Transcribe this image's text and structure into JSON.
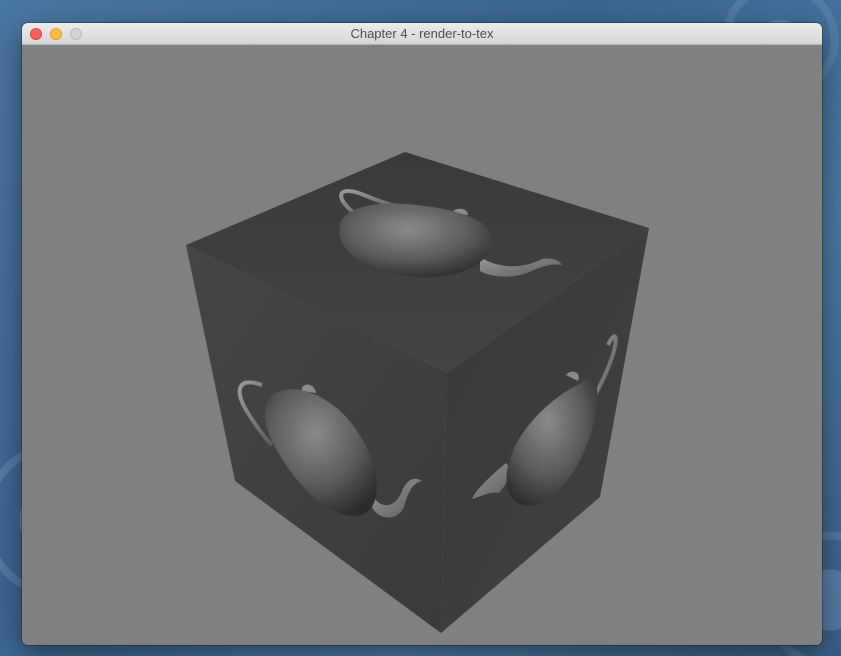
{
  "window": {
    "title": "Chapter 4 - render-to-tex",
    "buttons": {
      "close": "close",
      "minimize": "minimize",
      "zoom": "zoom"
    }
  },
  "viewport": {
    "background_color": "#808080",
    "object": "cube textured with teapot render",
    "cube_faces": [
      "top",
      "front",
      "right"
    ],
    "face_color": "#3e3e3e"
  }
}
